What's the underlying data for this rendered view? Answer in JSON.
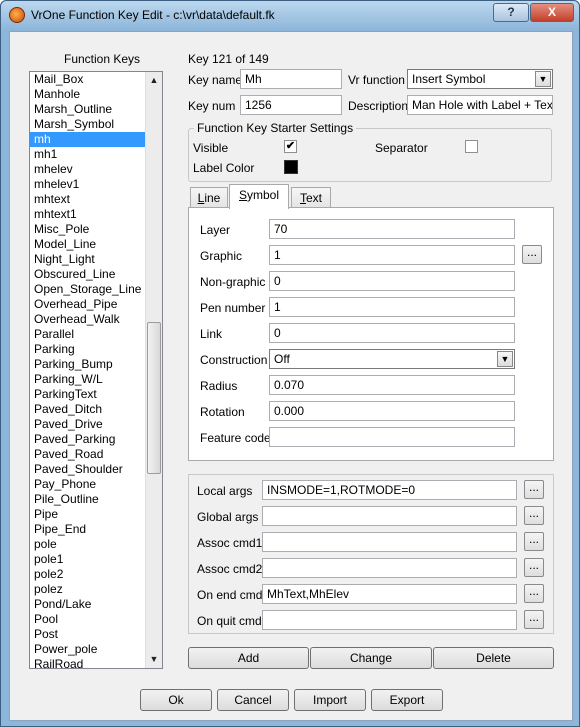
{
  "window": {
    "title": "VrOne Function Key Edit - c:\\vr\\data\\default.fk",
    "help_label": "?",
    "close_label": "X"
  },
  "list": {
    "heading": "Function Keys",
    "items": [
      "Mail_Box",
      "Manhole",
      "Marsh_Outline",
      "Marsh_Symbol",
      "mh",
      "mh1",
      "mhelev",
      "mhelev1",
      "mhtext",
      "mhtext1",
      "Misc_Pole",
      "Model_Line",
      "Night_Light",
      "Obscured_Line",
      "Open_Storage_Line",
      "Overhead_Pipe",
      "Overhead_Walk",
      "Parallel",
      "Parking",
      "Parking_Bump",
      "Parking_W/L",
      "ParkingText",
      "Paved_Ditch",
      "Paved_Drive",
      "Paved_Parking",
      "Paved_Road",
      "Paved_Shoulder",
      "Pay_Phone",
      "Pile_Outline",
      "Pipe",
      "Pipe_End",
      "pole",
      "pole1",
      "pole2",
      "polez",
      "Pond/Lake",
      "Pool",
      "Post",
      "Power_pole",
      "RailRoad"
    ],
    "selected": "mh"
  },
  "key": {
    "count_text": "Key 121 of 149",
    "name_label": "Key name",
    "name_value": "Mh",
    "num_label": "Key num",
    "num_value": "1256",
    "vrfunc_label": "Vr function",
    "vrfunc_value": "Insert Symbol",
    "desc_label": "Description",
    "desc_value": "Man Hole with Label + Text"
  },
  "starter": {
    "title": "Function Key Starter Settings",
    "visible_label": "Visible",
    "visible_checked": true,
    "separator_label": "Separator",
    "separator_checked": false,
    "label_color_label": "Label Color",
    "label_color": "#000000"
  },
  "tabs": [
    {
      "prefix": "",
      "mnemonic": "L",
      "rest": "ine"
    },
    {
      "prefix": "",
      "mnemonic": "S",
      "rest": "ymbol"
    },
    {
      "prefix": "",
      "mnemonic": "T",
      "rest": "ext"
    }
  ],
  "active_tab": "Symbol",
  "symbol": {
    "layer_label": "Layer",
    "layer_value": "70",
    "graphic_label": "Graphic",
    "graphic_value": "1",
    "nongraphic_label": "Non-graphic",
    "nongraphic_value": "0",
    "pen_label": "Pen number",
    "pen_value": "1",
    "link_label": "Link",
    "link_value": "0",
    "construction_label": "Construction",
    "construction_value": "Off",
    "radius_label": "Radius",
    "radius_value": "0.070",
    "rotation_label": "Rotation",
    "rotation_value": "0.000",
    "feature_label": "Feature code",
    "feature_value": ""
  },
  "args": {
    "local_label": "Local args",
    "local_value": "INSMODE=1,ROTMODE=0",
    "global_label": "Global args",
    "global_value": "",
    "assoc1_label": "Assoc cmd1",
    "assoc1_value": "",
    "assoc2_label": "Assoc cmd2",
    "assoc2_value": "",
    "onend_label": "On end cmd",
    "onend_value": "MhText,MhElev",
    "onquit_label": "On quit cmd",
    "onquit_value": ""
  },
  "browse_label": "...",
  "actions": {
    "add": "Add",
    "change": "Change",
    "delete": "Delete"
  },
  "footer": {
    "ok": "Ok",
    "cancel": "Cancel",
    "import": "Import",
    "export": "Export"
  },
  "icons": {
    "app": "vrone-app-icon",
    "help": "help-icon",
    "close": "close-icon",
    "check": "checkmark-icon",
    "scroll_up": "scroll-up-arrow-icon",
    "scroll_down": "scroll-down-arrow-icon",
    "dropdown": "chevron-down-icon"
  },
  "colors": {
    "selection": "#3399ff",
    "title_bar": "#8fb7da",
    "close_button": "#c3402a"
  }
}
